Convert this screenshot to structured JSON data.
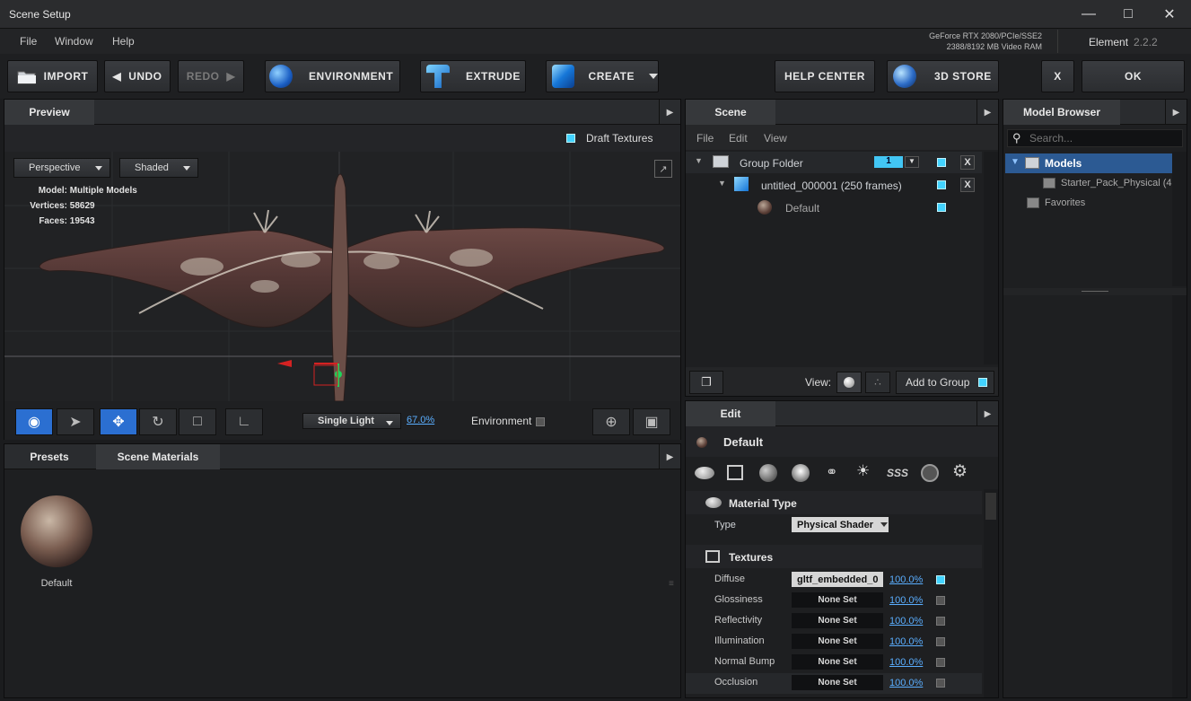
{
  "window": {
    "title": "Scene Setup"
  },
  "menu": [
    "File",
    "Window",
    "Help"
  ],
  "gpu": {
    "line1": "GeForce RTX 2080/PCIe/SSE2",
    "line2": "2388/8192 MB Video RAM"
  },
  "app": {
    "name": "Element",
    "version": "2.2.2"
  },
  "toolbar": {
    "import": "IMPORT",
    "undo": "UNDO",
    "redo": "REDO",
    "environment": "ENVIRONMENT",
    "extrude": "EXTRUDE",
    "create": "CREATE",
    "help": "HELP CENTER",
    "store": "3D STORE",
    "close": "X",
    "ok": "OK"
  },
  "preview": {
    "tab": "Preview",
    "draft_textures": "Draft Textures",
    "projection": "Perspective",
    "shading": "Shaded",
    "info": {
      "model_label": "Model:",
      "model": "Multiple Models",
      "vertices_label": "Vertices:",
      "vertices": "58629",
      "faces_label": "Faces:",
      "faces": "19543"
    },
    "light": "Single Light",
    "light_pct": "67.0%",
    "environment": "Environment"
  },
  "presets": {
    "tab1": "Presets",
    "tab2": "Scene Materials",
    "material": "Default"
  },
  "scene": {
    "tab": "Scene",
    "menu": [
      "File",
      "Edit",
      "View"
    ],
    "group": "Group Folder",
    "group_num": "1",
    "item": "untitled_000001 (250 frames)",
    "material": "Default",
    "view_label": "View:",
    "add_group": "Add to Group"
  },
  "browser": {
    "tab": "Model Browser",
    "search_placeholder": "Search...",
    "models": "Models",
    "starter": "Starter_Pack_Physical (4",
    "favorites": "Favorites"
  },
  "edit": {
    "tab": "Edit",
    "material": "Default",
    "sss": "SSS",
    "material_type": "Material Type",
    "type_label": "Type",
    "type_value": "Physical Shader",
    "textures": "Textures",
    "rows": [
      {
        "label": "Diffuse",
        "value": "gltf_embedded_0",
        "pct": "100.0%"
      },
      {
        "label": "Glossiness",
        "value": "None Set",
        "pct": "100.0%"
      },
      {
        "label": "Reflectivity",
        "value": "None Set",
        "pct": "100.0%"
      },
      {
        "label": "Illumination",
        "value": "None Set",
        "pct": "100.0%"
      },
      {
        "label": "Normal Bump",
        "value": "None Set",
        "pct": "100.0%"
      },
      {
        "label": "Occlusion",
        "value": "None Set",
        "pct": "100.0%"
      }
    ]
  }
}
